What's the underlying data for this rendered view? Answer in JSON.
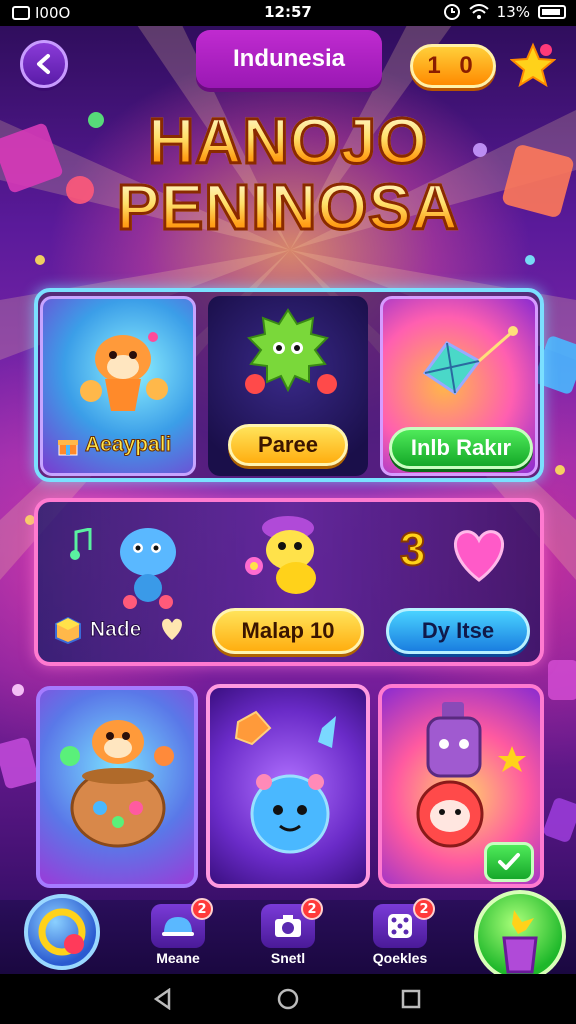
{
  "status_bar": {
    "left_text": "I00O",
    "time": "12:57",
    "battery": "13%"
  },
  "header": {
    "region_label": "Indunesia",
    "coin_value": "1 0"
  },
  "title": {
    "line1": "HANOJO",
    "line2": "PENINOSA"
  },
  "top_row": {
    "card1_label": "Aeaypali",
    "card2_button": "Paree",
    "card3_button": "Inlb Rakır"
  },
  "middle_row": {
    "left_label": "Nade",
    "center_button": "Malap 10",
    "counter": "3",
    "right_button": "Dy Itse"
  },
  "bottom_nav": {
    "items": [
      {
        "label": "Meane",
        "badge": "2"
      },
      {
        "label": "Snetl",
        "badge": "2"
      },
      {
        "label": "Qoekles",
        "badge": "2"
      }
    ]
  },
  "colors": {
    "accent_yellow": "#ffc21a",
    "accent_green": "#1eb82a",
    "accent_blue": "#2a8ef0",
    "badge_red": "#ff3a3a"
  }
}
